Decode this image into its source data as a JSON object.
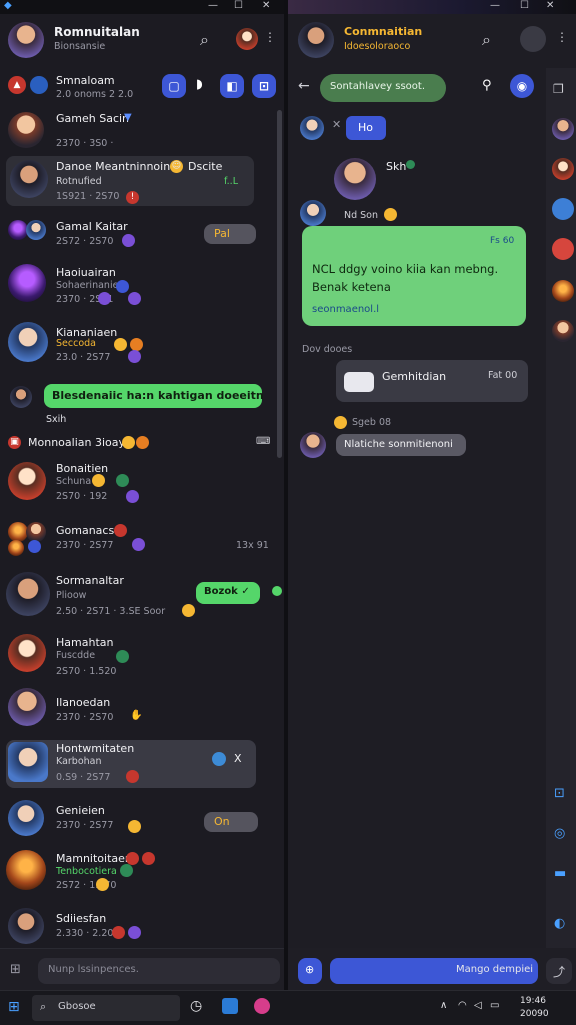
{
  "left_panel": {
    "title": "Romnuitalan",
    "subtitle": "Bionsansie",
    "tabs": [
      "Smnaloam",
      "",
      "",
      ""
    ],
    "tab_meta": "2.0 onoms 2 2.0",
    "rows": [
      {
        "name": "Gameh Sacin",
        "sub": "2370 · 3S0 ·",
        "extra": "▼"
      },
      {
        "name": "Danoe Meantninnoin",
        "sub": "Rotnufied",
        "time": "1S921 · 2S70",
        "badge": "Dscite",
        "time2": "f..L"
      },
      {
        "name": "Gamal Kaitar",
        "sub": "2S72 · 2S70",
        "bubble": "Pal"
      },
      {
        "name": "Haoiuairan",
        "sub": "Sohaerinanie",
        "time": "2370 · 2S71"
      },
      {
        "name": "Kiananiaen",
        "sub": "Seccoda",
        "time": "23.0 · 2S77"
      },
      {
        "name": "Monnoalian 3ioay",
        "sub": ""
      },
      {
        "name": "Bonaitien",
        "sub": "Schuna",
        "time": "2S70 · 192"
      },
      {
        "name": "Gomanacs",
        "sub": "2370 · 2S77",
        "time2": "13x 91"
      },
      {
        "name": "Sormanaltar",
        "sub": "Plioow",
        "time": "2.50 · 2S71 · 3.SE Soor",
        "bubble": "Bozok ✓"
      },
      {
        "name": "Hamahtan",
        "sub": "Fuscdde",
        "time": "2S70 · 1.520"
      },
      {
        "name": "Ilanoedan",
        "sub": "2370 · 2S70"
      },
      {
        "name": "Hontwmitaten",
        "sub": "Karbohan",
        "time": "0.S9 · 2S77",
        "badge2": "X"
      },
      {
        "name": "Genieien",
        "sub": "2370 · 2S77",
        "bubble": "On"
      },
      {
        "name": "Mamnitoitaen",
        "sub": "Tenbocotiera",
        "time": "2S72 · 1.670"
      },
      {
        "name": "Sdiiesfan",
        "sub": "2.330 · 2.20"
      }
    ],
    "green_banner": "Blesdenaiic ha:n kahtigan doeeitn",
    "banner_time": "Sxih",
    "compose_placeholder": "Nunp lssinpences."
  },
  "right_panel": {
    "title": "Conmnaitian",
    "subtitle": "Idoesoloraoco",
    "search_pill": "Sontahlavey ssoot.",
    "msg1_label": "Ho",
    "msg2_name": "Skh",
    "msg2_sub": "Nd Son",
    "big_bubble_time": "Fs 60",
    "big_bubble_line1": "NCL ddgy voino kiia kan mebng.",
    "big_bubble_line2": "Benak ketena",
    "big_bubble_link": "seonmaenol.l",
    "section_label": "Dov dooes",
    "card_title": "Gemhitdian",
    "card_time": "Fat 00",
    "react_label": "Sgeb 08",
    "reply_pill": "Nlatiche sonmitienoni",
    "compose_placeholder": "Mango dempiei"
  },
  "taskbar": {
    "search": "Gbosoe",
    "clock_time": "19:46",
    "clock_date": "20090"
  },
  "colors": {
    "accent_blue": "#3d57d6",
    "bubble_green": "#55d66a",
    "bg": "#1c1b22"
  }
}
